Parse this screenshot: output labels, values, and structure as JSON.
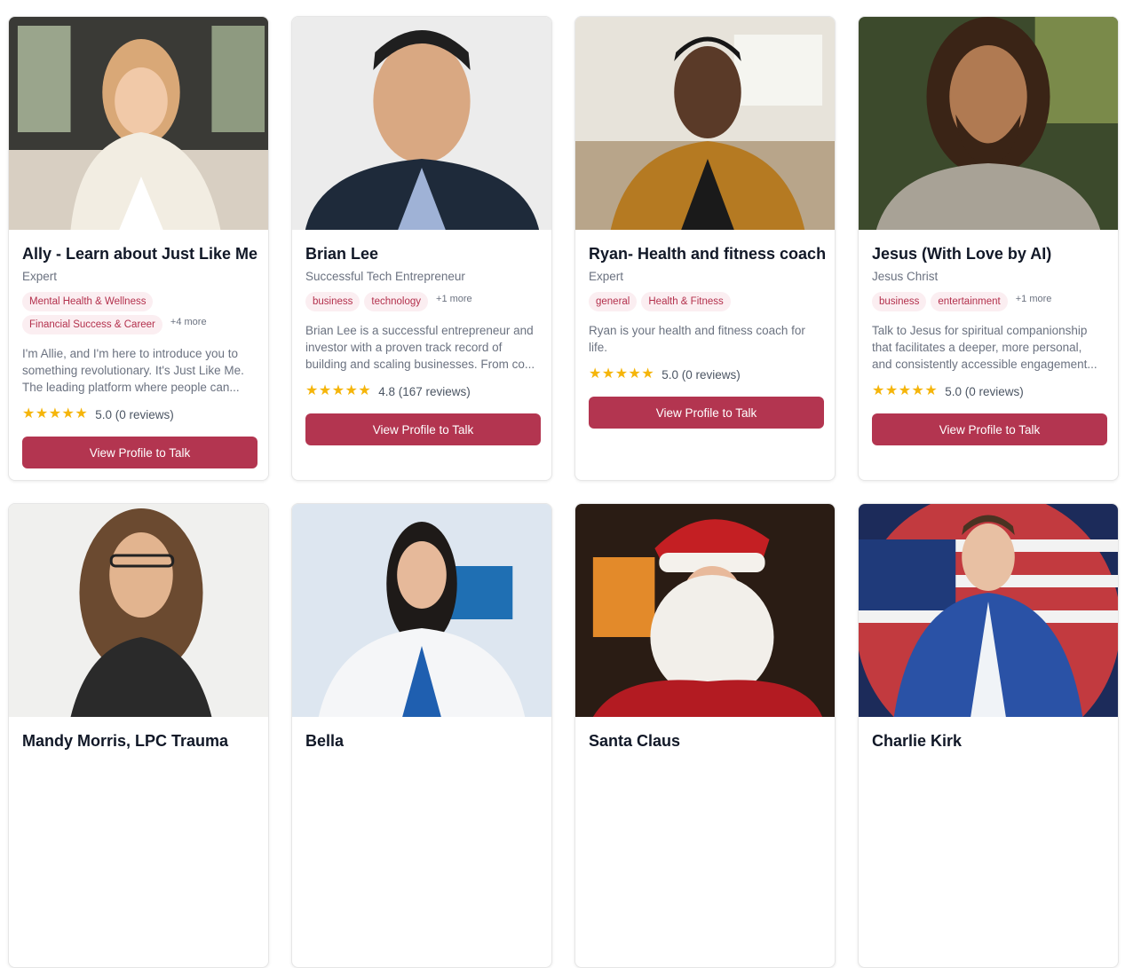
{
  "cards": [
    {
      "name": "Ally - Learn about Just Like Me",
      "subtitle": "Expert",
      "tags": [
        "Mental Health & Wellness",
        "Financial Success & Career"
      ],
      "more": "+4 more",
      "description": "I'm Allie, and I'm here to introduce you to something revolutionary. It's Just Like Me. The leading platform where people can...",
      "rating_text": "5.0 (0 reviews)",
      "rating": 5,
      "button": "View Profile to Talk"
    },
    {
      "name": "Brian Lee",
      "subtitle": "Successful Tech Entrepreneur",
      "tags": [
        "business",
        "technology"
      ],
      "more": "+1 more",
      "description": "Brian Lee is a successful entrepreneur and investor with a proven track record of building and scaling businesses. From co...",
      "rating_text": "4.8 (167 reviews)",
      "rating": 4.8,
      "button": "View Profile to Talk"
    },
    {
      "name": "Ryan- Health and fitness coach",
      "subtitle": "Expert",
      "tags": [
        "general",
        "Health & Fitness"
      ],
      "more": "",
      "description": "Ryan is your health and fitness coach for life.",
      "rating_text": "5.0 (0 reviews)",
      "rating": 5,
      "button": "View Profile to Talk"
    },
    {
      "name": "Jesus (With Love by AI)",
      "subtitle": "Jesus Christ",
      "tags": [
        "business",
        "entertainment"
      ],
      "more": "+1 more",
      "description": "Talk to Jesus for spiritual companionship that facilitates a deeper, more personal, and consistently accessible engagement...",
      "rating_text": "5.0 (0 reviews)",
      "rating": 5,
      "button": "View Profile to Talk"
    },
    {
      "name": "Mandy Morris, LPC Trauma"
    },
    {
      "name": "Bella"
    },
    {
      "name": "Santa Claus"
    },
    {
      "name": "Charlie Kirk"
    }
  ],
  "icons": {
    "star": "star-icon"
  },
  "colors": {
    "accent": "#b33550",
    "tag_text": "#b3304c",
    "tag_bg": "#fbeef1",
    "star": "#f5b50a"
  }
}
